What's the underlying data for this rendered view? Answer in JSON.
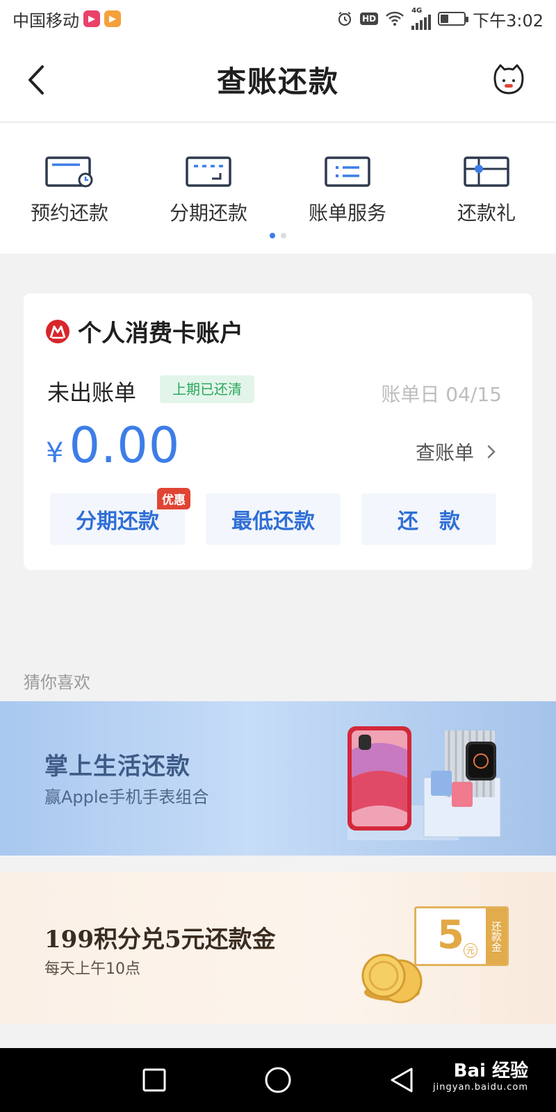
{
  "status_bar": {
    "carrier": "中国移动",
    "network": "4G",
    "hd": "HD",
    "time": "下午3:02",
    "battery_level": 0.35
  },
  "header": {
    "title": "查账还款"
  },
  "quick_actions": [
    {
      "label": "预约还款",
      "icon": "card-clock-icon"
    },
    {
      "label": "分期还款",
      "icon": "card-installment-icon"
    },
    {
      "label": "账单服务",
      "icon": "bill-list-icon"
    },
    {
      "label": "还款礼",
      "icon": "gift-card-icon"
    }
  ],
  "pager": {
    "pages": 2,
    "active": 0
  },
  "account": {
    "title": "个人消费卡账户",
    "bill_label": "未出账单",
    "bill_status": "上期已还清",
    "bill_date": "账单日 04/15",
    "currency": "¥",
    "amount": "0.00",
    "view_bill": "查账单",
    "buttons": {
      "installment": "分期还款",
      "installment_tag": "优惠",
      "minimum": "最低还款",
      "repay": "还　款"
    }
  },
  "recommend": {
    "title": "猜你喜欢",
    "banner1": {
      "title": "掌上生活还款",
      "subtitle": "赢Apple手机手表组合"
    },
    "banner2": {
      "title": "199积分兑5元还款金",
      "subtitle": "每天上午10点",
      "coupon_value": "5",
      "coupon_unit": "元",
      "coupon_label": "还款金"
    }
  },
  "watermark": {
    "brand": "Bai 经验",
    "url": "jingyan.baidu.com"
  },
  "colors": {
    "accent": "#3d7de8",
    "success": "#2aa85c",
    "promo": "#e04434",
    "bank": "#d8262b"
  }
}
